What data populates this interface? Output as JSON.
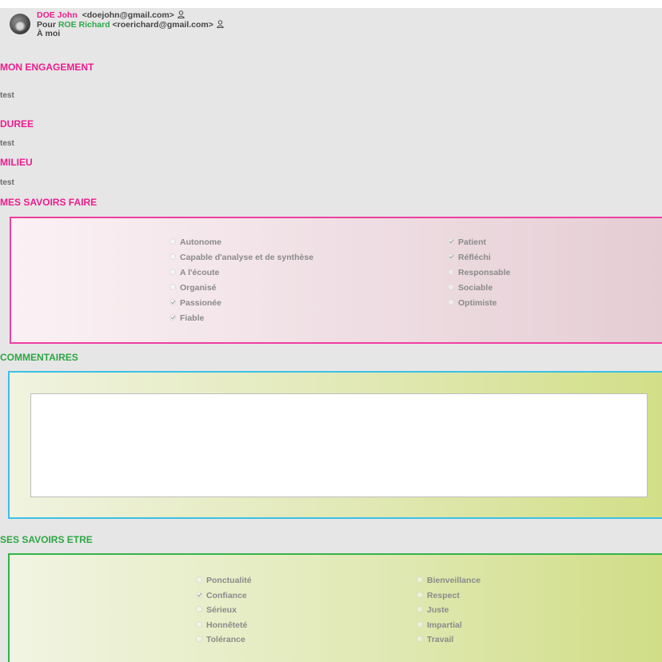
{
  "email": {
    "from_name": "DOE John",
    "from_email": "<doejohn@gmail.com>",
    "to_prefix": "Pour",
    "to_name": "ROE Richard",
    "to_email": "<roerichard@gmail.com>",
    "cc": "À moi"
  },
  "sections": {
    "engagement": {
      "title": "MON ENGAGEMENT",
      "value": "test"
    },
    "duree": {
      "title": "DUREE",
      "value": "test"
    },
    "milieu": {
      "title": "MILIEU",
      "value": "test"
    },
    "savoirs_faire": {
      "title": "MES SAVOIRS FAIRE",
      "left": [
        {
          "label": "Autonome",
          "checked": false
        },
        {
          "label": "Capable d'analyse et de synthèse",
          "checked": false
        },
        {
          "label": "A l'écoute",
          "checked": false
        },
        {
          "label": "Organisé",
          "checked": false
        },
        {
          "label": "Passionée",
          "checked": true
        },
        {
          "label": "Fiable",
          "checked": true
        }
      ],
      "right": [
        {
          "label": "Patient",
          "checked": true
        },
        {
          "label": "Réfléchi",
          "checked": true
        },
        {
          "label": "Responsable",
          "checked": false
        },
        {
          "label": "Sociable",
          "checked": false
        },
        {
          "label": "Optimiste",
          "checked": false
        }
      ]
    },
    "commentaires": {
      "title": "COMMENTAIRES",
      "value": ""
    },
    "savoirs_etre": {
      "title": "SES SAVOIRS ETRE",
      "left": [
        {
          "label": "Ponctualité",
          "checked": false
        },
        {
          "label": "Confiance",
          "checked": true
        },
        {
          "label": "Sérieux",
          "checked": false
        },
        {
          "label": "Honnêteté",
          "checked": false
        },
        {
          "label": "Tolérance",
          "checked": false
        }
      ],
      "right": [
        {
          "label": "Bienveillance",
          "checked": false
        },
        {
          "label": "Respect",
          "checked": false
        },
        {
          "label": "Juste",
          "checked": false
        },
        {
          "label": "Impartial",
          "checked": false
        },
        {
          "label": "Travail",
          "checked": false
        }
      ]
    }
  },
  "colors": {
    "pink": "#ee1c8e",
    "green": "#2ea644",
    "blue_border": "#3dbfe4",
    "background": "#e6e6e6"
  }
}
